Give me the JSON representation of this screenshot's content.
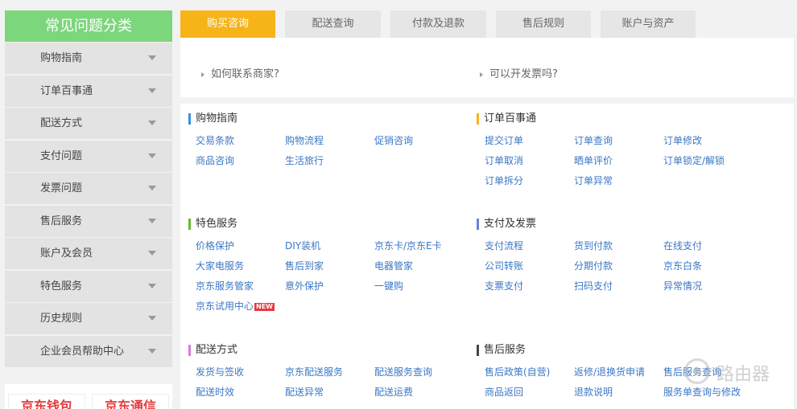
{
  "sidebar": {
    "title": "常见问题分类",
    "items": [
      {
        "label": "购物指南"
      },
      {
        "label": "订单百事通"
      },
      {
        "label": "配送方式"
      },
      {
        "label": "支付问题"
      },
      {
        "label": "发票问题"
      },
      {
        "label": "售后服务"
      },
      {
        "label": "账户及会员"
      },
      {
        "label": "特色服务"
      },
      {
        "label": "历史规则"
      },
      {
        "label": "企业会员帮助中心"
      }
    ],
    "promo": [
      "京东钱包",
      "京东通信"
    ]
  },
  "tabs": [
    {
      "label": "购买咨询",
      "active": true
    },
    {
      "label": "配送查询",
      "active": false
    },
    {
      "label": "付款及退款",
      "active": false
    },
    {
      "label": "售后规则",
      "active": false
    },
    {
      "label": "账户与资产",
      "active": false
    }
  ],
  "faq": [
    "如何联系商家?",
    "可以开发票吗?"
  ],
  "sections": [
    {
      "title": "购物指南",
      "color": "#3b8fe0",
      "links": [
        "交易条款",
        "购物流程",
        "促销咨询",
        "商品咨询",
        "生活旅行"
      ]
    },
    {
      "title": "订单百事通",
      "color": "#f6b419",
      "links": [
        "提交订单",
        "订单查询",
        "订单修改",
        "订单取消",
        "晒单评价",
        "订单锁定/解锁",
        "订单拆分",
        "订单异常"
      ]
    },
    {
      "title": "特色服务",
      "color": "#66b82e",
      "links": [
        "价格保护",
        "DIY装机",
        "京东卡/京东E卡",
        "大家电服务",
        "售后到家",
        "电器管家",
        "京东服务管家",
        "意外保护",
        "一键购",
        "京东试用中心"
      ],
      "new_badge": "NEW"
    },
    {
      "title": "支付及发票",
      "color": "#6c7fd8",
      "links": [
        "支付流程",
        "货到付款",
        "在线支付",
        "公司转账",
        "分期付款",
        "京东白条",
        "支票支付",
        "扫码支付",
        "异常情况"
      ]
    },
    {
      "title": "配送方式",
      "color": "#d979d9",
      "links": [
        "发货与签收",
        "京东配送服务",
        "配送服务查询",
        "配送时效",
        "配送异常",
        "配送运费"
      ]
    },
    {
      "title": "售后服务",
      "color": "#444444",
      "links": [
        "售后政策(自营)",
        "返修/退换货申请",
        "售后服务查询",
        "商品返回",
        "退款说明",
        "服务单查询与修改"
      ]
    }
  ],
  "watermark": "路由器"
}
